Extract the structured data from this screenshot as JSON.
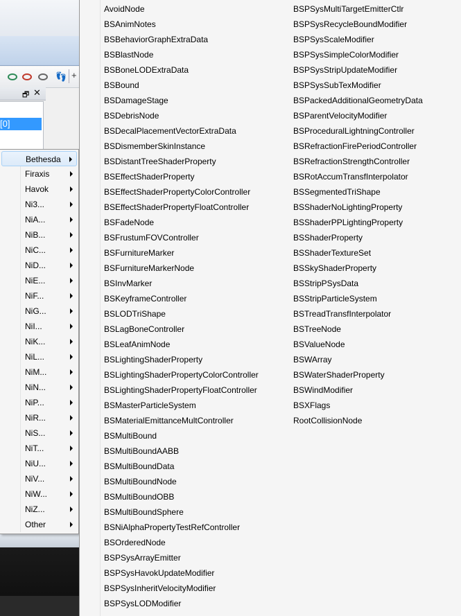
{
  "background": {
    "selected_row_text": "[0]",
    "panel_restore_glyph": "🗗",
    "panel_close_glyph": "✕",
    "toolbar_plus_glyph": "+",
    "toolbar_feet_glyph": "👣"
  },
  "menu_categories": [
    "Bethesda",
    "Firaxis",
    "Havok",
    "Ni3...",
    "NiA...",
    "NiB...",
    "NiC...",
    "NiD...",
    "NiE...",
    "NiF...",
    "NiG...",
    "NiI...",
    "NiK...",
    "NiL...",
    "NiM...",
    "NiN...",
    "NiP...",
    "NiR...",
    "NiS...",
    "NiT...",
    "NiU...",
    "NiV...",
    "NiW...",
    "NiZ...",
    "Other"
  ],
  "bethesda_column_1": [
    "AvoidNode",
    "BSAnimNotes",
    "BSBehaviorGraphExtraData",
    "BSBlastNode",
    "BSBoneLODExtraData",
    "BSBound",
    "BSDamageStage",
    "BSDebrisNode",
    "BSDecalPlacementVectorExtraData",
    "BSDismemberSkinInstance",
    "BSDistantTreeShaderProperty",
    "BSEffectShaderProperty",
    "BSEffectShaderPropertyColorController",
    "BSEffectShaderPropertyFloatController",
    "BSFadeNode",
    "BSFrustumFOVController",
    "BSFurnitureMarker",
    "BSFurnitureMarkerNode",
    "BSInvMarker",
    "BSKeyframeController",
    "BSLODTriShape",
    "BSLagBoneController",
    "BSLeafAnimNode",
    "BSLightingShaderProperty",
    "BSLightingShaderPropertyColorController",
    "BSLightingShaderPropertyFloatController",
    "BSMasterParticleSystem",
    "BSMaterialEmittanceMultController",
    "BSMultiBound",
    "BSMultiBoundAABB",
    "BSMultiBoundData",
    "BSMultiBoundNode",
    "BSMultiBoundOBB",
    "BSMultiBoundSphere",
    "BSNiAlphaPropertyTestRefController",
    "BSOrderedNode",
    "BSPSysArrayEmitter",
    "BSPSysHavokUpdateModifier",
    "BSPSysInheritVelocityModifier",
    "BSPSysLODModifier"
  ],
  "bethesda_column_2": [
    "BSPSysMultiTargetEmitterCtlr",
    "BSPSysRecycleBoundModifier",
    "BSPSysScaleModifier",
    "BSPSysSimpleColorModifier",
    "BSPSysStripUpdateModifier",
    "BSPSysSubTexModifier",
    "BSPackedAdditionalGeometryData",
    "BSParentVelocityModifier",
    "BSProceduralLightningController",
    "BSRefractionFirePeriodController",
    "BSRefractionStrengthController",
    "BSRotAccumTransfInterpolator",
    "BSSegmentedTriShape",
    "BSShaderNoLightingProperty",
    "BSShaderPPLightingProperty",
    "BSShaderProperty",
    "BSShaderTextureSet",
    "BSSkyShaderProperty",
    "BSStripPSysData",
    "BSStripParticleSystem",
    "BSTreadTransfInterpolator",
    "BSTreeNode",
    "BSValueNode",
    "BSWArray",
    "BSWaterShaderProperty",
    "BSWindModifier",
    "BSXFlags",
    "RootCollisionNode"
  ]
}
